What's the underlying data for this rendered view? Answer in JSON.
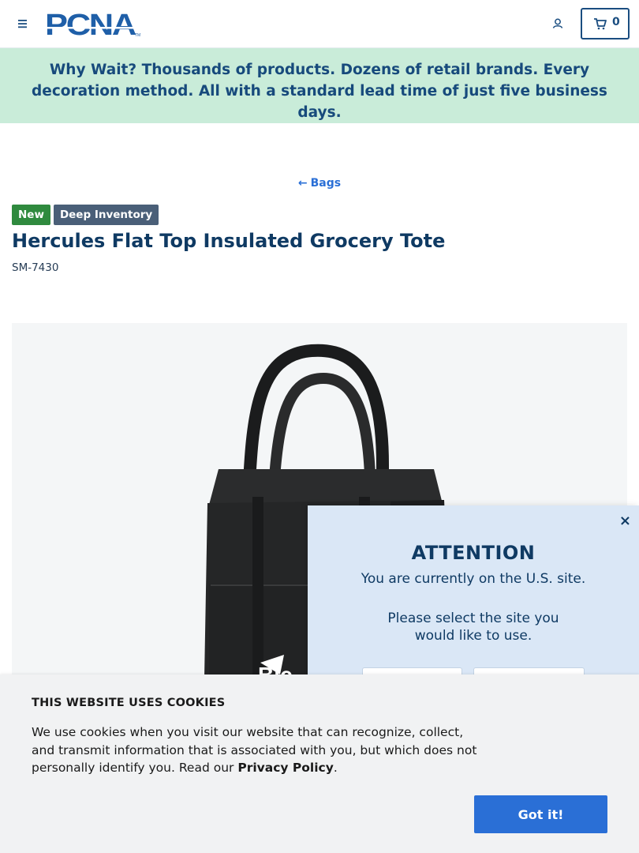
{
  "header": {
    "logo_text": "PCNA",
    "cart_count": "0",
    "icons": {
      "menu": "hamburger-menu-icon",
      "account": "user-icon",
      "cart": "cart-icon"
    }
  },
  "promo": {
    "lead": "Why Wait?",
    "text": " Thousands of products. Dozens of retail brands. Every decoration method. All with a standard lead time of just five business days."
  },
  "breadcrumb": {
    "arrow": "←",
    "label": "Bags"
  },
  "badges": [
    "New",
    "Deep Inventory"
  ],
  "product": {
    "title": "Hercules Flat Top Insulated Grocery Tote",
    "sku": "SM-7430"
  },
  "attention": {
    "close": "×",
    "title": "ATTENTION",
    "line1": "You are currently on the U.S. site.",
    "line2": "Please select the site you would like to use."
  },
  "cookie": {
    "title": "THIS WEBSITE USES COOKIES",
    "text": "We use cookies when you visit our website that can recognize, collect, and transmit information that is associated with you, but which does not personally identify you. Read our ",
    "link": "Privacy Policy",
    "end": ".",
    "button": "Got it!"
  },
  "colors": {
    "brand_navy": "#0f3a63",
    "link_blue": "#2a6fd6",
    "promo_bg": "#c9ecd9",
    "badge_new": "#2f8a3e",
    "badge_deep": "#4a5f78",
    "modal_bg": "#dae7f6"
  }
}
